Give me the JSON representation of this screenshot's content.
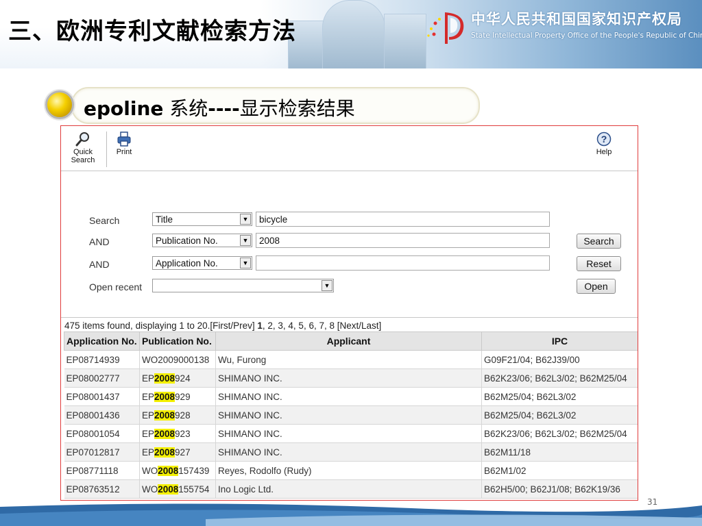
{
  "slide": {
    "title": "三、欧洲专利文献检索方法",
    "logo_cn": "中华人民共和国国家知识产权局",
    "logo_en": "State Intellectual Property Office of the People's Republic of China",
    "subtitle_bold": "epoline",
    "subtitle_rest": " 系统",
    "subtitle_dash": "----",
    "subtitle_tail": "显示检索结果",
    "page_number": "31"
  },
  "toolbar": {
    "quick_search_line1": "Quick",
    "quick_search_line2": "Search",
    "print": "Print",
    "help": "Help"
  },
  "form": {
    "rows": [
      {
        "label": "Search",
        "field": "Title",
        "value": "bicycle"
      },
      {
        "label": "AND",
        "field": "Publication No.",
        "value": "2008"
      },
      {
        "label": "AND",
        "field": "Application No.",
        "value": ""
      }
    ],
    "open_recent_label": "Open recent",
    "open_recent_value": "",
    "search_button": "Search",
    "reset_button": "Reset",
    "open_button": "Open"
  },
  "results": {
    "summary_pre": "475 items found, displaying 1 to 20.[First/Prev] ",
    "current_page": "1",
    "summary_post": ", 2, 3, 4, 5, 6, 7, 8 [Next/Last]",
    "columns": [
      "Application No.",
      "Publication No.",
      "Applicant",
      "IPC"
    ],
    "rows": [
      {
        "app": "EP08714939",
        "pub_pre": "WO2009000138",
        "pub_hl": "",
        "pub_post": "",
        "applicant": "Wu, Furong",
        "ipc": "G09F21/04; B62J39/00"
      },
      {
        "app": "EP08002777",
        "pub_pre": "EP",
        "pub_hl": "2008",
        "pub_post": "924",
        "applicant": "SHIMANO INC.",
        "ipc": "B62K23/06; B62L3/02; B62M25/04"
      },
      {
        "app": "EP08001437",
        "pub_pre": "EP",
        "pub_hl": "2008",
        "pub_post": "929",
        "applicant": "SHIMANO INC.",
        "ipc": "B62M25/04; B62L3/02"
      },
      {
        "app": "EP08001436",
        "pub_pre": "EP",
        "pub_hl": "2008",
        "pub_post": "928",
        "applicant": "SHIMANO INC.",
        "ipc": "B62M25/04; B62L3/02"
      },
      {
        "app": "EP08001054",
        "pub_pre": "EP",
        "pub_hl": "2008",
        "pub_post": "923",
        "applicant": "SHIMANO INC.",
        "ipc": "B62K23/06; B62L3/02; B62M25/04"
      },
      {
        "app": "EP07012817",
        "pub_pre": "EP",
        "pub_hl": "2008",
        "pub_post": "927",
        "applicant": "SHIMANO INC.",
        "ipc": "B62M11/18"
      },
      {
        "app": "EP08771118",
        "pub_pre": "WO",
        "pub_hl": "2008",
        "pub_post": "157439",
        "applicant": "Reyes, Rodolfo (Rudy)",
        "ipc": "B62M1/02"
      },
      {
        "app": "EP08763512",
        "pub_pre": "WO",
        "pub_hl": "2008",
        "pub_post": "155754",
        "applicant": "Ino Logic Ltd.",
        "ipc": "B62H5/00; B62J1/08; B62K19/36"
      }
    ]
  },
  "colors": {
    "highlight": "#f4f000",
    "frame": "#e03a3a",
    "header_sky": "#5b8fbf"
  },
  "icons": [
    "magnifier-icon",
    "printer-icon",
    "help-icon",
    "dropdown-arrow-icon",
    "bullet-icon",
    "sipo-emblem-icon"
  ]
}
